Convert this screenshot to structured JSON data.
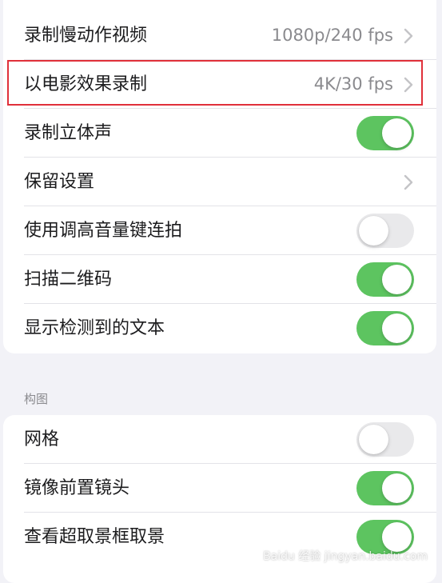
{
  "group1": {
    "rows": [
      {
        "label": "录制慢动作视频",
        "value": "1080p/240 fps"
      },
      {
        "label": "以电影效果录制",
        "value": "4K/30 fps"
      },
      {
        "label": "录制立体声",
        "toggle_on": true
      },
      {
        "label": "保留设置"
      },
      {
        "label": "使用调高音量键连拍",
        "toggle_on": false
      },
      {
        "label": "扫描二维码",
        "toggle_on": true
      },
      {
        "label": "显示检测到的文本",
        "toggle_on": true
      }
    ]
  },
  "section_header": "构图",
  "group2": {
    "rows": [
      {
        "label": "网格",
        "toggle_on": false
      },
      {
        "label": "镜像前置镜头",
        "toggle_on": true
      },
      {
        "label": "查看超取景框取景",
        "toggle_on": true
      }
    ]
  },
  "colors": {
    "toggle_on": "#5dc460",
    "toggle_off": "#e9e9eb",
    "highlight": "#e0303a"
  },
  "icons": {
    "chevron": "chevron-right-icon"
  },
  "watermark": "Baidu 经验 jingyan.baidu.com"
}
